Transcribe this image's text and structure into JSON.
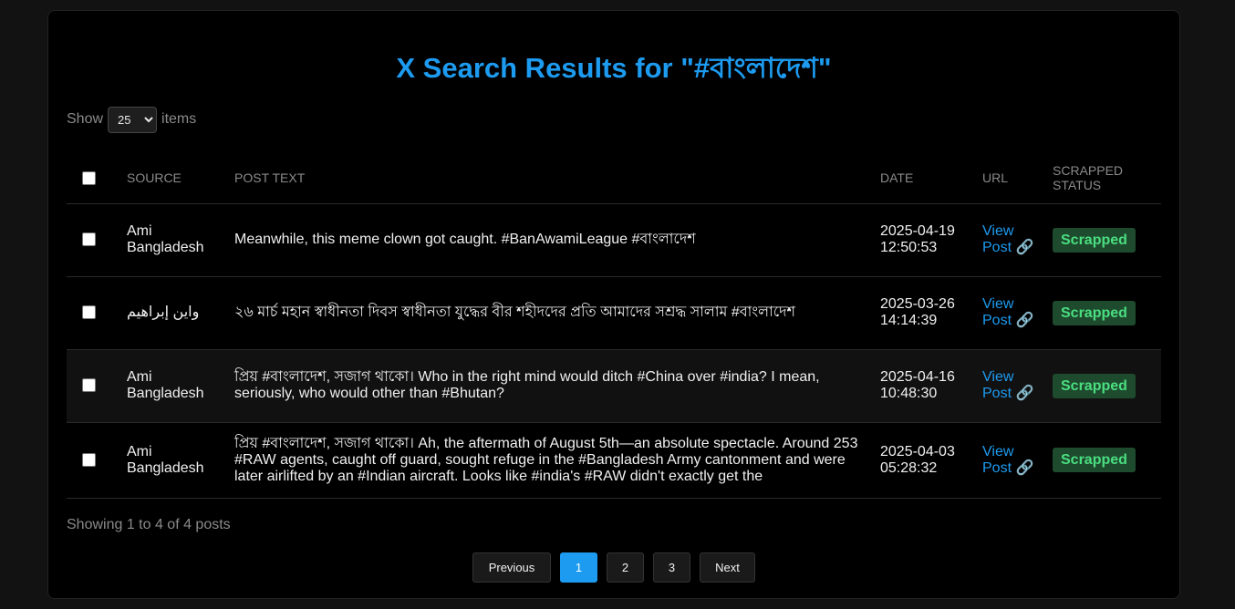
{
  "title": "X Search Results for \"#বাংলাদেশ\"",
  "length_menu": {
    "show_label": "Show",
    "selected": "25",
    "items_label": "items"
  },
  "table": {
    "headers": {
      "source": "SOURCE",
      "post_text": "POST TEXT",
      "date": "DATE",
      "url": "URL",
      "status": "SCRAPPED STATUS"
    },
    "rows": [
      {
        "source": "Ami Bangladesh",
        "post_text": "Meanwhile, this meme clown got caught. #BanAwamiLeague #বাংলাদেশ",
        "date": "2025-04-19 12:50:53",
        "url_label": "View Post 🔗",
        "status": "Scrapped"
      },
      {
        "source": "واين إبراهيم",
        "post_text": "২৬ মার্চ মহান স্বাধীনতা দিবস স্বাধীনতা যুদ্ধের বীর শহীদদের প্রতি আমাদের সশ্রদ্ধ সালাম #বাংলাদেশ",
        "date": "2025-03-26 14:14:39",
        "url_label": "View Post 🔗",
        "status": "Scrapped"
      },
      {
        "source": "Ami Bangladesh",
        "post_text": "প্রিয় #বাংলাদেশ, সজাগ থাকো। Who in the right mind would ditch #China over #india? I mean, seriously, who would other than #Bhutan?",
        "date": "2025-04-16 10:48:30",
        "url_label": "View Post 🔗",
        "status": "Scrapped"
      },
      {
        "source": "Ami Bangladesh",
        "post_text": "প্রিয় #বাংলাদেশ, সজাগ থাকো। Ah, the aftermath of August 5th—an absolute spectacle. Around 253 #RAW agents, caught off guard, sought refuge in the #Bangladesh Army cantonment and were later airlifted by an #Indian aircraft. Looks like #india's #RAW didn't exactly get the",
        "date": "2025-04-03 05:28:32",
        "url_label": "View Post 🔗",
        "status": "Scrapped"
      }
    ]
  },
  "info_text": "Showing 1 to 4 of 4 posts",
  "pagination": {
    "previous": "Previous",
    "pages": [
      "1",
      "2",
      "3"
    ],
    "active_page": "1",
    "next": "Next"
  },
  "colors": {
    "accent": "#1d9bf0",
    "status_bg": "#1e4b2e",
    "status_text": "#4ade80"
  }
}
